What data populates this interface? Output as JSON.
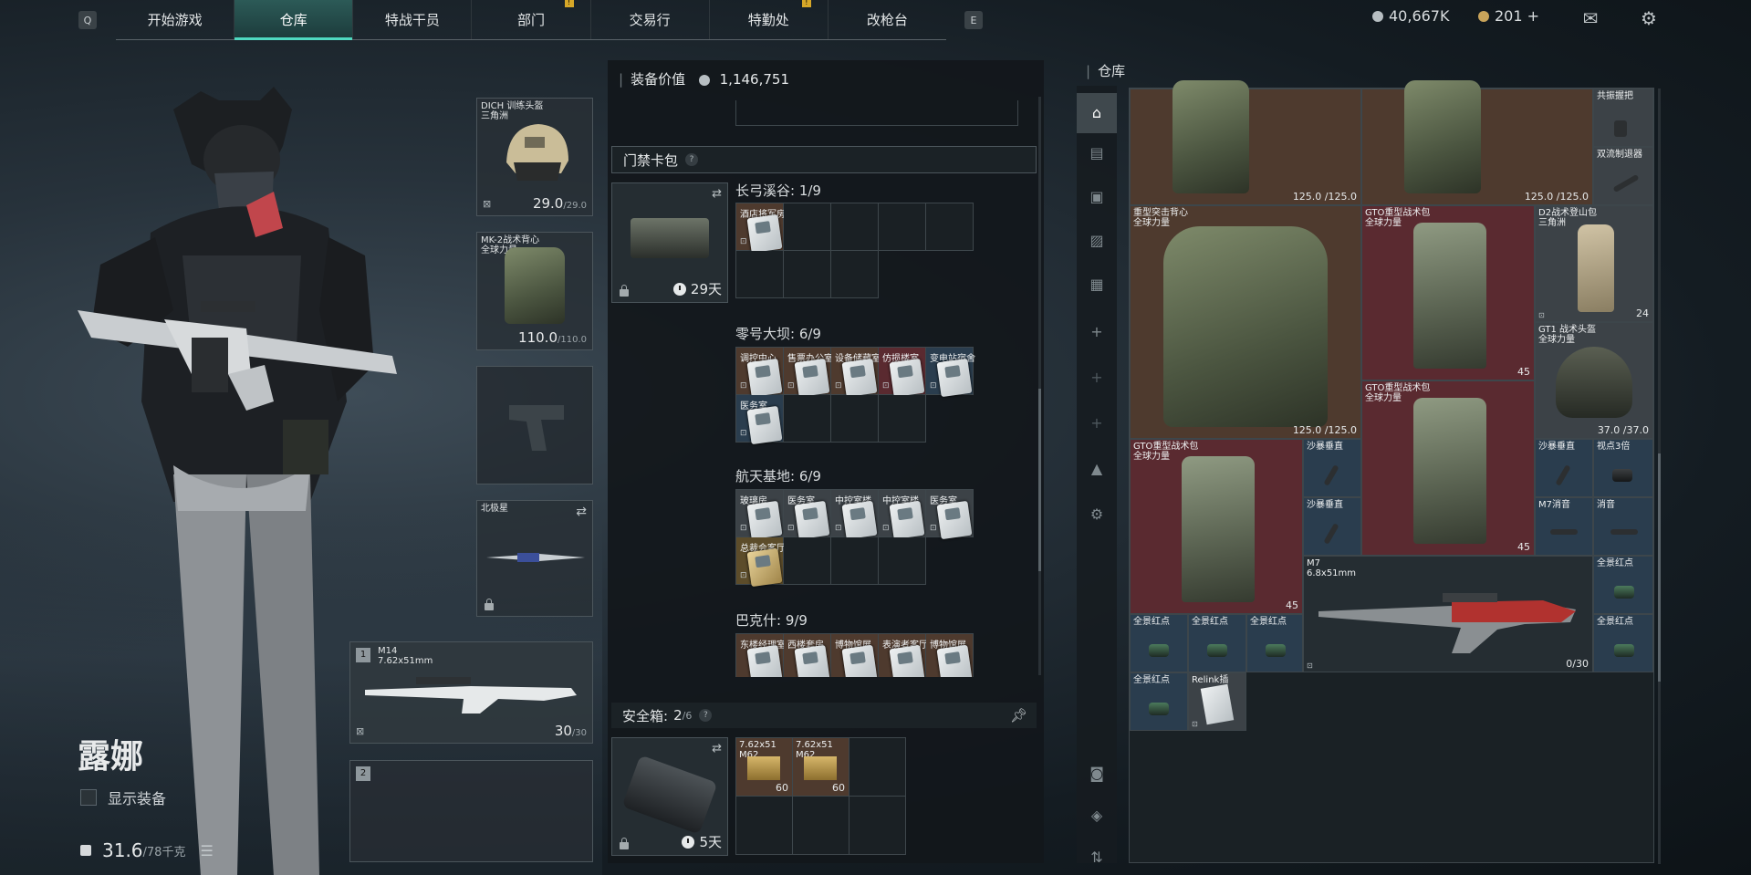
{
  "topbar": {
    "key_left": "Q",
    "key_right": "E",
    "tabs": [
      "开始游戏",
      "仓库",
      "特战干员",
      "部门",
      "交易行",
      "特勤处",
      "改枪台"
    ],
    "active_tab": "仓库",
    "warn_mark": "!",
    "currency_silver": "40,667K",
    "currency_gold": "201 +"
  },
  "character": {
    "name": "露娜",
    "show_gear_label": "显示装备",
    "weight_current": "31.6",
    "weight_max": "/78千克"
  },
  "gear": {
    "helmet": {
      "label": "DICH 训练头盔\n三角洲",
      "durability": "29.0",
      "durability_max": "/29.0"
    },
    "armor": {
      "label": "MK-2战术背心\n全球力量",
      "durability": "110.0",
      "durability_max": "/110.0"
    },
    "melee": {
      "label": "北极星"
    },
    "primary": {
      "slot_no": "1",
      "label": "M14\n7.62x51mm",
      "ammo": "30",
      "ammo_max": "/30"
    },
    "secondary": {
      "slot_no": "2"
    }
  },
  "middle": {
    "equip_value_label": "装备价值",
    "equip_value": "1,146,751",
    "keycard_section": "门禁卡包",
    "keycard_days": "29天",
    "groups": [
      {
        "title": "长弓溪谷: 1/9",
        "cards": [
          "酒店将军房"
        ]
      },
      {
        "title": "零号大坝: 6/9",
        "cards": [
          "调控中心",
          "售票办公室",
          "设备储藏室",
          "仿损楼室",
          "变电站宿舍",
          "医务室"
        ]
      },
      {
        "title": "航天基地: 6/9",
        "cards": [
          "玻璃房",
          "医务室",
          "中控室楼",
          "中控室楼",
          "医务室",
          "总裁会客厅"
        ]
      },
      {
        "title": "巴克什: 9/9",
        "cards": [
          "东楼经理室",
          "西楼套房",
          "博物馆展",
          "表演者客厅",
          "博物馆展"
        ]
      }
    ],
    "safebox_label": "安全箱:",
    "safebox_count": "2",
    "safebox_max": "/6",
    "safebox_days": "5天",
    "ammo": [
      {
        "name": "7.62x51\nM62",
        "count": "60"
      },
      {
        "name": "7.62x51\nM62",
        "count": "60"
      }
    ]
  },
  "right": {
    "title": "仓库",
    "items": {
      "grip": "共振握把",
      "muzzle": "双流制退器",
      "top_vest_dur": "125.0 /125.0",
      "heavy_vest_label": "重型突击背心\n全球力量",
      "heavy_vest_dur": "125.0 /125.0",
      "gto_label": "GTO重型战术包\n全球力量",
      "gto_count": "45",
      "d2_label": "D2战术登山包\n三角洲",
      "d2_count": "24",
      "gt1_label": "GT1 战术头盔\n全球力量",
      "gt1_dur": "37.0 /37.0",
      "sand_grip": "沙暴垂直",
      "view3x": "视点3倍",
      "m7_supp": "M7消音",
      "supp": "消音",
      "m7_label": "M7\n6.8x51mm",
      "m7_ammo": "0/30",
      "red_dot": "全景红点",
      "relink": "Relink插"
    }
  }
}
